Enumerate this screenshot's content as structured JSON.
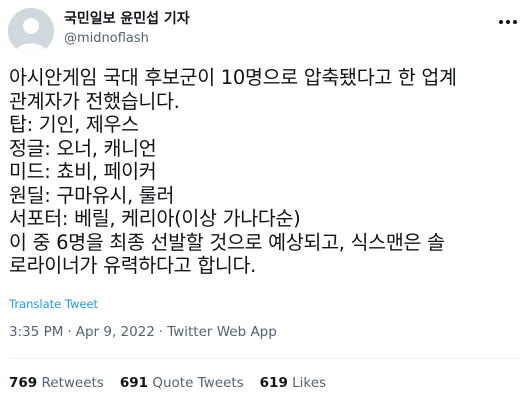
{
  "author": {
    "name": "국민일보 윤민섭 기자",
    "handle": "@midnoflash",
    "avatar_icon": "default-avatar-icon"
  },
  "tweet": {
    "lines": [
      "아시안게임 국대 후보군이 10명으로 압축됐다고 한 업계",
      "관계자가 전했습니다.",
      "탑: 기인, 제우스",
      "정글: 오너, 캐니언",
      "미드: 쵸비, 페이커",
      "원딜: 구마유시, 룰러",
      "서포터: 베릴, 케리아(이상 가나다순)",
      "이 중 6명을 최종 선발할 것으로 예상되고, 식스맨은 솔",
      "로라이너가 유력하다고 합니다."
    ],
    "translate_label": "Translate Tweet"
  },
  "meta": {
    "time": "3:35 PM",
    "separator1": "·",
    "date": "Apr 9, 2022",
    "separator2": "·",
    "source": "Twitter Web App"
  },
  "stats": {
    "retweets_count": "769",
    "retweets_label": "Retweets",
    "quotes_count": "691",
    "quotes_label": "Quote Tweets",
    "likes_count": "619",
    "likes_label": "Likes"
  },
  "colors": {
    "link": "#1d9bf0",
    "secondary_text": "#536471",
    "primary_text": "#0f1419",
    "avatar_bg": "#cfd9de"
  }
}
